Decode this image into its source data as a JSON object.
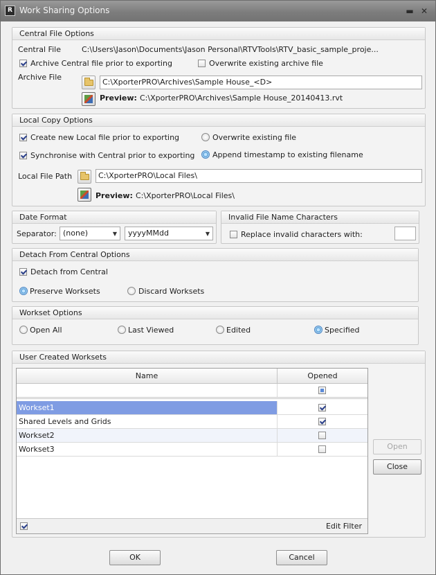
{
  "window": {
    "title": "Work Sharing Options",
    "icon": "revit-app-icon"
  },
  "central": {
    "header": "Central File Options",
    "file_label": "Central File",
    "file_path": "C:\\Users\\Jason\\Documents\\Jason Personal\\RTVTools\\RTV_basic_sample_proje...",
    "archive_checkbox": "Archive Central file prior to exporting",
    "archive_checked": true,
    "overwrite_checkbox": "Overwrite existing archive file",
    "overwrite_checked": false,
    "archive_label": "Archive File",
    "archive_value": "C:\\XporterPRO\\Archives\\Sample House_<D>",
    "preview_label": "Preview:",
    "preview_value": "C:\\XporterPRO\\Archives\\Sample House_20140413.rvt"
  },
  "local": {
    "header": "Local Copy Options",
    "create_checkbox": "Create new Local file prior to exporting",
    "create_checked": true,
    "sync_checkbox": "Synchronise with Central prior to exporting",
    "sync_checked": true,
    "overwrite_radio": "Overwrite existing file",
    "append_radio": "Append timestamp to existing filename",
    "selected_radio": "append",
    "path_label": "Local File Path",
    "path_value": "C:\\XporterPRO\\Local Files\\",
    "preview_label": "Preview:",
    "preview_value": "C:\\XporterPRO\\Local Files\\"
  },
  "date_format": {
    "header": "Date Format",
    "separator_label": "Separator:",
    "separator_value": "(none)",
    "format_value": "yyyyMMdd"
  },
  "invalid_chars": {
    "header": "Invalid File Name Characters",
    "replace_checkbox": "Replace invalid characters with:",
    "replace_checked": false,
    "replace_value": ""
  },
  "detach": {
    "header": "Detach From Central Options",
    "detach_checkbox": "Detach from Central",
    "detach_checked": true,
    "preserve_radio": "Preserve Worksets",
    "discard_radio": "Discard Worksets",
    "selected_radio": "preserve"
  },
  "workset_options": {
    "header": "Workset Options",
    "options": [
      "Open All",
      "Last Viewed",
      "Edited",
      "Specified"
    ],
    "selected": "Specified"
  },
  "user_worksets": {
    "header": "User Created Worksets",
    "columns": [
      "Name",
      "Opened"
    ],
    "rows": [
      {
        "name": "Workset1",
        "opened": true,
        "selected": true
      },
      {
        "name": "Shared Levels and Grids",
        "opened": true,
        "selected": false
      },
      {
        "name": "Workset2",
        "opened": false,
        "selected": false
      },
      {
        "name": "Workset3",
        "opened": false,
        "selected": false
      }
    ],
    "filter_checked": true,
    "edit_filter_label": "Edit Filter",
    "open_button": "Open",
    "close_button": "Close"
  },
  "footer": {
    "ok_button": "OK",
    "cancel_button": "Cancel"
  },
  "colors": {
    "selected_row": "#7f9ce3",
    "title_bar": "#858585",
    "radio_selected": "#4e9ad6"
  }
}
